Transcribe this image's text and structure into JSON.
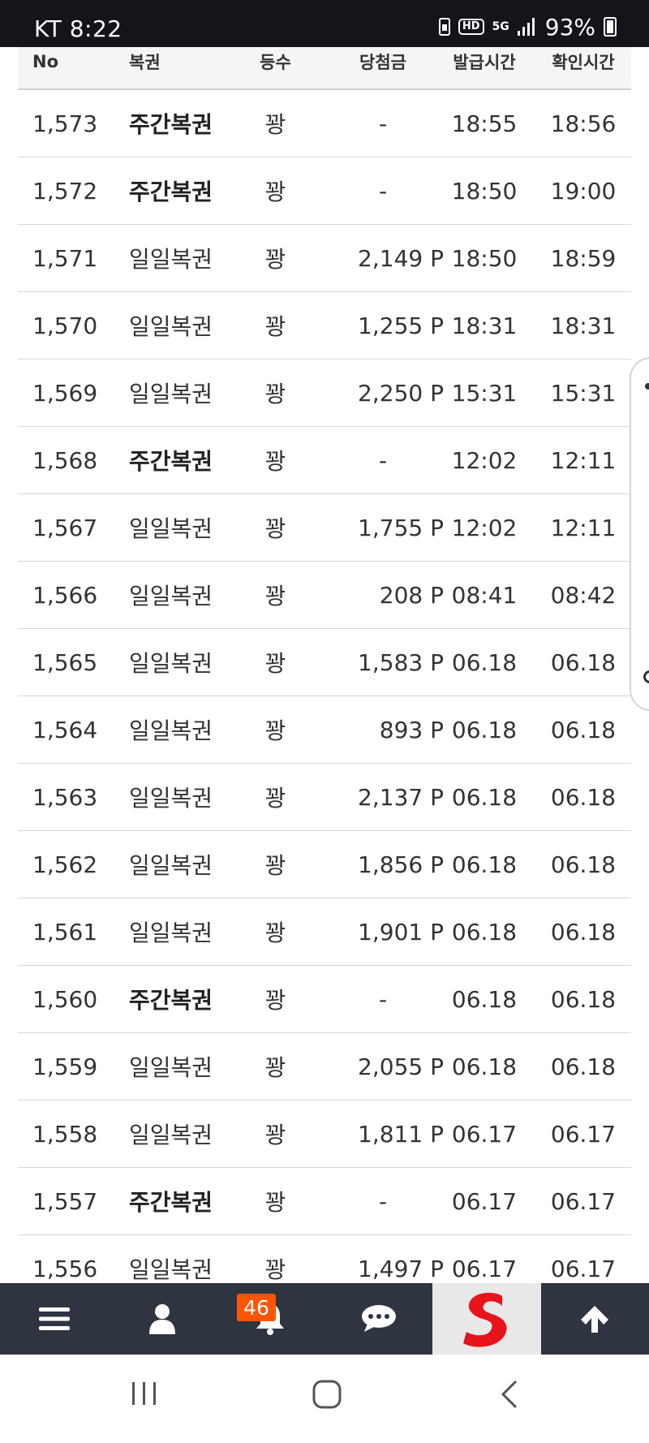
{
  "status_bar": {
    "carrier_time": "KT 8:22",
    "battery_percent": "93%",
    "icons": [
      "battery-saver-icon",
      "hd-voice-icon",
      "5g-icon",
      "signal-icon",
      "battery-icon"
    ]
  },
  "table": {
    "headers": {
      "no": "No",
      "name": "복권",
      "grade": "등수",
      "prize": "당첨금",
      "issued": "발급시간",
      "checked": "확인시간"
    },
    "rows": [
      {
        "no": "1,573",
        "name": "주간복권",
        "grade": "꽝",
        "prize": "-",
        "issued": "18:55",
        "checked": "18:56",
        "weekly": true
      },
      {
        "no": "1,572",
        "name": "주간복권",
        "grade": "꽝",
        "prize": "-",
        "issued": "18:50",
        "checked": "19:00",
        "weekly": true
      },
      {
        "no": "1,571",
        "name": "일일복권",
        "grade": "꽝",
        "prize": "2,149 P",
        "issued": "18:50",
        "checked": "18:59",
        "weekly": false
      },
      {
        "no": "1,570",
        "name": "일일복권",
        "grade": "꽝",
        "prize": "1,255 P",
        "issued": "18:31",
        "checked": "18:31",
        "weekly": false
      },
      {
        "no": "1,569",
        "name": "일일복권",
        "grade": "꽝",
        "prize": "2,250 P",
        "issued": "15:31",
        "checked": "15:31",
        "weekly": false
      },
      {
        "no": "1,568",
        "name": "주간복권",
        "grade": "꽝",
        "prize": "-",
        "issued": "12:02",
        "checked": "12:11",
        "weekly": true
      },
      {
        "no": "1,567",
        "name": "일일복권",
        "grade": "꽝",
        "prize": "1,755 P",
        "issued": "12:02",
        "checked": "12:11",
        "weekly": false
      },
      {
        "no": "1,566",
        "name": "일일복권",
        "grade": "꽝",
        "prize": "208 P",
        "issued": "08:41",
        "checked": "08:42",
        "weekly": false
      },
      {
        "no": "1,565",
        "name": "일일복권",
        "grade": "꽝",
        "prize": "1,583 P",
        "issued": "06.18",
        "checked": "06.18",
        "weekly": false
      },
      {
        "no": "1,564",
        "name": "일일복권",
        "grade": "꽝",
        "prize": "893 P",
        "issued": "06.18",
        "checked": "06.18",
        "weekly": false
      },
      {
        "no": "1,563",
        "name": "일일복권",
        "grade": "꽝",
        "prize": "2,137 P",
        "issued": "06.18",
        "checked": "06.18",
        "weekly": false
      },
      {
        "no": "1,562",
        "name": "일일복권",
        "grade": "꽝",
        "prize": "1,856 P",
        "issued": "06.18",
        "checked": "06.18",
        "weekly": false
      },
      {
        "no": "1,561",
        "name": "일일복권",
        "grade": "꽝",
        "prize": "1,901 P",
        "issued": "06.18",
        "checked": "06.18",
        "weekly": false
      },
      {
        "no": "1,560",
        "name": "주간복권",
        "grade": "꽝",
        "prize": "-",
        "issued": "06.18",
        "checked": "06.18",
        "weekly": true
      },
      {
        "no": "1,559",
        "name": "일일복권",
        "grade": "꽝",
        "prize": "2,055 P",
        "issued": "06.18",
        "checked": "06.18",
        "weekly": false
      },
      {
        "no": "1,558",
        "name": "일일복권",
        "grade": "꽝",
        "prize": "1,811 P",
        "issued": "06.17",
        "checked": "06.17",
        "weekly": false
      },
      {
        "no": "1,557",
        "name": "주간복권",
        "grade": "꽝",
        "prize": "-",
        "issued": "06.17",
        "checked": "06.17",
        "weekly": true
      },
      {
        "no": "1,556",
        "name": "일일복권",
        "grade": "꽝",
        "prize": "1,497 P",
        "issued": "06.17",
        "checked": "06.17",
        "weekly": false
      }
    ]
  },
  "bottom_nav": {
    "items": [
      "menu-icon",
      "user-icon",
      "bell-icon",
      "chat-icon",
      "brand-logo",
      "arrow-up-icon"
    ],
    "notification_count": "46",
    "colors": {
      "bar": "#2e3440",
      "badge": "#ff5500",
      "brand_red": "#e8141b"
    }
  },
  "system_nav": {
    "items": [
      "recents-button",
      "home-button",
      "back-button"
    ]
  }
}
